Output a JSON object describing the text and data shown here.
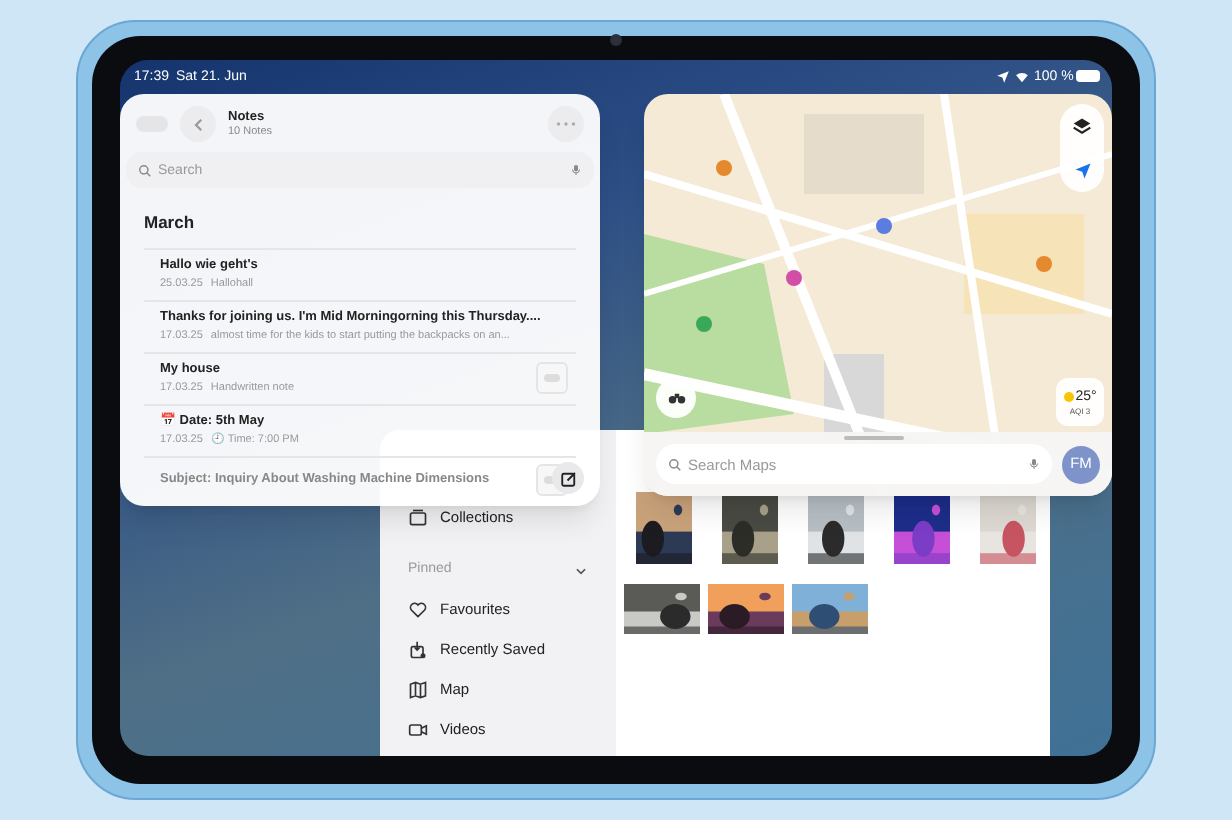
{
  "status_bar": {
    "time": "17:39",
    "date": "Sat 21. Jun",
    "battery": "100 %"
  },
  "notes_window": {
    "title": "Notes",
    "subtitle": "10 Notes",
    "search": {
      "placeholder": "Search"
    },
    "section": "March",
    "notes": [
      {
        "title": "Hallo wie geht's",
        "date": "25.03.25",
        "preview": "Hallohall",
        "thumbnail": false
      },
      {
        "title": "Thanks for joining us. I'm Mid Morningorning this Thursday....",
        "date": "17.03.25",
        "preview": "almost time for the kids to start putting the backpacks on an...",
        "thumbnail": false
      },
      {
        "title": "My house",
        "date": "17.03.25",
        "preview": "Handwritten note",
        "thumbnail": true
      },
      {
        "title": "📅 Date: 5th May",
        "date": "17.03.25",
        "preview": "🕘 Time: 7:00 PM",
        "thumbnail": false
      },
      {
        "title": "Subject: Inquiry About Washing Machine Dimensions",
        "thumbnail": true
      }
    ]
  },
  "maps_window": {
    "search": {
      "placeholder": "Search Maps"
    },
    "avatar": "FM",
    "weather": {
      "temperature": "25°",
      "aqi": "AQI 3"
    }
  },
  "photos_window": {
    "sidebar": {
      "items": [
        {
          "label": "Collections",
          "kind": "collections"
        }
      ],
      "pinned": {
        "label": "Pinned",
        "expanded": true,
        "items": [
          {
            "label": "Favourites",
            "kind": "heart"
          },
          {
            "label": "Recently Saved",
            "kind": "saved"
          },
          {
            "label": "Map",
            "kind": "map"
          },
          {
            "label": "Videos",
            "kind": "video"
          }
        ]
      }
    }
  }
}
